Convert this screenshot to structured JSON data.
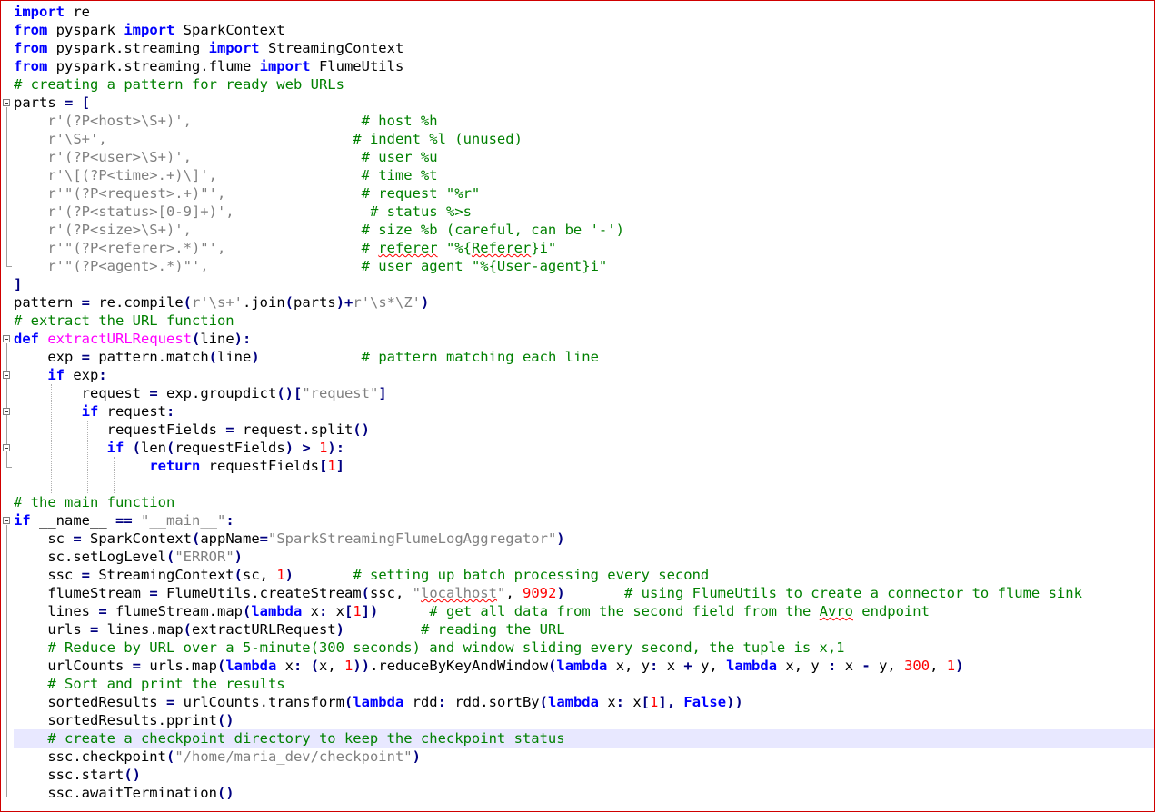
{
  "editor": {
    "language": "python",
    "current_line": 41,
    "colors": {
      "keyword": "#0000ff",
      "comment": "#008000",
      "string": "#808080",
      "number": "#ff0000",
      "function_def": "#ff00ff",
      "current_line_bg": "#e8e8ff",
      "frame_border": "#d00000"
    },
    "lines": [
      [
        [
          "kw",
          "import"
        ],
        [
          "t",
          " re"
        ]
      ],
      [
        [
          "kw",
          "from"
        ],
        [
          "t",
          " pyspark "
        ],
        [
          "kw",
          "import"
        ],
        [
          "t",
          " SparkContext"
        ]
      ],
      [
        [
          "kw",
          "from"
        ],
        [
          "t",
          " pyspark.streaming "
        ],
        [
          "kw",
          "import"
        ],
        [
          "t",
          " StreamingContext"
        ]
      ],
      [
        [
          "kw",
          "from"
        ],
        [
          "t",
          " pyspark.streaming.flume "
        ],
        [
          "kw",
          "import"
        ],
        [
          "t",
          " FlumeUtils"
        ]
      ],
      [
        [
          "cm",
          "# creating a pattern for ready web URLs"
        ]
      ],
      [
        [
          "t",
          "parts "
        ],
        [
          "op",
          "="
        ],
        [
          "t",
          " "
        ],
        [
          "op",
          "["
        ]
      ],
      [
        [
          "t",
          "    "
        ],
        [
          "st",
          "r'(?P<host>\\S+)',"
        ],
        [
          "t",
          "                    "
        ],
        [
          "cm",
          "# host %h"
        ]
      ],
      [
        [
          "t",
          "    "
        ],
        [
          "st",
          "r'\\S+',"
        ],
        [
          "t",
          "                             "
        ],
        [
          "cm",
          "# indent %l (unused)"
        ]
      ],
      [
        [
          "t",
          "    "
        ],
        [
          "st",
          "r'(?P<user>\\S+)',"
        ],
        [
          "t",
          "                    "
        ],
        [
          "cm",
          "# user %u"
        ]
      ],
      [
        [
          "t",
          "    "
        ],
        [
          "st",
          "r'\\[(?P<time>.+)\\]',"
        ],
        [
          "t",
          "                 "
        ],
        [
          "cm",
          "# time %t"
        ]
      ],
      [
        [
          "t",
          "    "
        ],
        [
          "st",
          "r'\"(?P<request>.+)\"',"
        ],
        [
          "t",
          "                "
        ],
        [
          "cm",
          "# request \"%r\""
        ]
      ],
      [
        [
          "t",
          "    "
        ],
        [
          "st",
          "r'(?P<status>[0-9]+)',"
        ],
        [
          "t",
          "                "
        ],
        [
          "cm",
          "# status %>s"
        ]
      ],
      [
        [
          "t",
          "    "
        ],
        [
          "st",
          "r'(?P<size>\\S+)',"
        ],
        [
          "t",
          "                    "
        ],
        [
          "cm",
          "# size %b (careful, can be '-')"
        ]
      ],
      [
        [
          "t",
          "    "
        ],
        [
          "st",
          "r'\"(?P<referer>.*)\"',"
        ],
        [
          "t",
          "                "
        ],
        [
          "cm",
          "# "
        ],
        [
          "cmsq",
          "referer"
        ],
        [
          "cm",
          " \"%{"
        ],
        [
          "cmsq",
          "Referer"
        ],
        [
          "cm",
          "}i\""
        ]
      ],
      [
        [
          "t",
          "    "
        ],
        [
          "st",
          "r'\"(?P<agent>.*)\"',"
        ],
        [
          "t",
          "                  "
        ],
        [
          "cm",
          "# user agent \"%{User-agent}i\""
        ]
      ],
      [
        [
          "op",
          "]"
        ]
      ],
      [
        [
          "t",
          "pattern "
        ],
        [
          "op",
          "="
        ],
        [
          "t",
          " re.compile"
        ],
        [
          "op",
          "("
        ],
        [
          "st",
          "r'\\s+'"
        ],
        [
          "t",
          ".join"
        ],
        [
          "op",
          "("
        ],
        [
          "t",
          "parts"
        ],
        [
          "op",
          ")+"
        ],
        [
          "st",
          "r'\\s*\\Z'"
        ],
        [
          "op",
          ")"
        ]
      ],
      [
        [
          "cm",
          "# extract the URL function"
        ]
      ],
      [
        [
          "kw",
          "def"
        ],
        [
          "t",
          " "
        ],
        [
          "fn",
          "extractURLRequest"
        ],
        [
          "op",
          "("
        ],
        [
          "t",
          "line"
        ],
        [
          "op",
          "):"
        ]
      ],
      [
        [
          "t",
          "    exp "
        ],
        [
          "op",
          "="
        ],
        [
          "t",
          " pattern.match"
        ],
        [
          "op",
          "("
        ],
        [
          "t",
          "line"
        ],
        [
          "op",
          ")"
        ],
        [
          "t",
          "            "
        ],
        [
          "cm",
          "# pattern matching each line"
        ]
      ],
      [
        [
          "t",
          "    "
        ],
        [
          "kw",
          "if"
        ],
        [
          "t",
          " exp"
        ],
        [
          "op",
          ":"
        ]
      ],
      [
        [
          "t",
          "        request "
        ],
        [
          "op",
          "="
        ],
        [
          "t",
          " exp.groupdict"
        ],
        [
          "op",
          "()["
        ],
        [
          "st",
          "\"request\""
        ],
        [
          "op",
          "]"
        ]
      ],
      [
        [
          "t",
          "        "
        ],
        [
          "kw",
          "if"
        ],
        [
          "t",
          " request"
        ],
        [
          "op",
          ":"
        ]
      ],
      [
        [
          "t",
          "           requestFields "
        ],
        [
          "op",
          "="
        ],
        [
          "t",
          " request.split"
        ],
        [
          "op",
          "()"
        ]
      ],
      [
        [
          "t",
          "           "
        ],
        [
          "kw",
          "if"
        ],
        [
          "t",
          " "
        ],
        [
          "op",
          "("
        ],
        [
          "t",
          "len"
        ],
        [
          "op",
          "("
        ],
        [
          "t",
          "requestFields"
        ],
        [
          "op",
          ")"
        ],
        [
          "t",
          " "
        ],
        [
          "op",
          ">"
        ],
        [
          "t",
          " "
        ],
        [
          "nm",
          "1"
        ],
        [
          "op",
          "):"
        ]
      ],
      [
        [
          "t",
          "                "
        ],
        [
          "kw",
          "return"
        ],
        [
          "t",
          " requestFields"
        ],
        [
          "op",
          "["
        ],
        [
          "nm",
          "1"
        ],
        [
          "op",
          "]"
        ]
      ],
      [],
      [
        [
          "cm",
          "# the main function"
        ]
      ],
      [
        [
          "kw",
          "if"
        ],
        [
          "t",
          " __name__ "
        ],
        [
          "op",
          "=="
        ],
        [
          "t",
          " "
        ],
        [
          "st",
          "\"__main__\""
        ],
        [
          "op",
          ":"
        ]
      ],
      [
        [
          "t",
          "    sc "
        ],
        [
          "op",
          "="
        ],
        [
          "t",
          " SparkContext"
        ],
        [
          "op",
          "("
        ],
        [
          "t",
          "appName"
        ],
        [
          "op",
          "="
        ],
        [
          "st",
          "\"SparkStreamingFlumeLogAggregator\""
        ],
        [
          "op",
          ")"
        ]
      ],
      [
        [
          "t",
          "    sc.setLogLevel"
        ],
        [
          "op",
          "("
        ],
        [
          "st",
          "\"ERROR\""
        ],
        [
          "op",
          ")"
        ]
      ],
      [
        [
          "t",
          "    ssc "
        ],
        [
          "op",
          "="
        ],
        [
          "t",
          " StreamingContext"
        ],
        [
          "op",
          "("
        ],
        [
          "t",
          "sc, "
        ],
        [
          "nm",
          "1"
        ],
        [
          "op",
          ")"
        ],
        [
          "t",
          "       "
        ],
        [
          "cm",
          "# setting up batch processing every second"
        ]
      ],
      [
        [
          "t",
          "    flumeStream "
        ],
        [
          "op",
          "="
        ],
        [
          "t",
          " FlumeUtils.createStream"
        ],
        [
          "op",
          "("
        ],
        [
          "t",
          "ssc, "
        ],
        [
          "st",
          "\""
        ],
        [
          "stsq",
          "localhost"
        ],
        [
          "st",
          "\""
        ],
        [
          "t",
          ", "
        ],
        [
          "nm",
          "9092"
        ],
        [
          "op",
          ")"
        ],
        [
          "t",
          "       "
        ],
        [
          "cm",
          "# using FlumeUtils to create a connector to flume sink"
        ]
      ],
      [
        [
          "t",
          "    lines "
        ],
        [
          "op",
          "="
        ],
        [
          "t",
          " flumeStream.map"
        ],
        [
          "op",
          "("
        ],
        [
          "kw",
          "lambda"
        ],
        [
          "t",
          " x"
        ],
        [
          "op",
          ":"
        ],
        [
          "t",
          " x"
        ],
        [
          "op",
          "["
        ],
        [
          "nm",
          "1"
        ],
        [
          "op",
          "])"
        ],
        [
          "t",
          "      "
        ],
        [
          "cm",
          "# get all data from the second field from the "
        ],
        [
          "cmsq",
          "Avro"
        ],
        [
          "cm",
          " endpoint"
        ]
      ],
      [
        [
          "t",
          "    urls "
        ],
        [
          "op",
          "="
        ],
        [
          "t",
          " lines.map"
        ],
        [
          "op",
          "("
        ],
        [
          "t",
          "extractURLRequest"
        ],
        [
          "op",
          ")"
        ],
        [
          "t",
          "         "
        ],
        [
          "cm",
          "# reading the URL"
        ]
      ],
      [
        [
          "t",
          "    "
        ],
        [
          "cm",
          "# Reduce by URL over a 5-minute(300 seconds) and window sliding every second, the tuple is x,1"
        ]
      ],
      [
        [
          "t",
          "    urlCounts "
        ],
        [
          "op",
          "="
        ],
        [
          "t",
          " urls.map"
        ],
        [
          "op",
          "("
        ],
        [
          "kw",
          "lambda"
        ],
        [
          "t",
          " x"
        ],
        [
          "op",
          ":"
        ],
        [
          "t",
          " "
        ],
        [
          "op",
          "("
        ],
        [
          "t",
          "x, "
        ],
        [
          "nm",
          "1"
        ],
        [
          "op",
          "))"
        ],
        [
          "t",
          ".reduceByKeyAndWindow"
        ],
        [
          "op",
          "("
        ],
        [
          "kw",
          "lambda"
        ],
        [
          "t",
          " x, y"
        ],
        [
          "op",
          ":"
        ],
        [
          "t",
          " x "
        ],
        [
          "op",
          "+"
        ],
        [
          "t",
          " y, "
        ],
        [
          "kw",
          "lambda"
        ],
        [
          "t",
          " x, y "
        ],
        [
          "op",
          ":"
        ],
        [
          "t",
          " x "
        ],
        [
          "op",
          "-"
        ],
        [
          "t",
          " y, "
        ],
        [
          "nm",
          "300"
        ],
        [
          "t",
          ", "
        ],
        [
          "nm",
          "1"
        ],
        [
          "op",
          ")"
        ]
      ],
      [
        [
          "t",
          "    "
        ],
        [
          "cm",
          "# Sort and print the results"
        ]
      ],
      [
        [
          "t",
          "    sortedResults "
        ],
        [
          "op",
          "="
        ],
        [
          "t",
          " urlCounts.transform"
        ],
        [
          "op",
          "("
        ],
        [
          "kw",
          "lambda"
        ],
        [
          "t",
          " rdd"
        ],
        [
          "op",
          ":"
        ],
        [
          "t",
          " rdd.sortBy"
        ],
        [
          "op",
          "("
        ],
        [
          "kw",
          "lambda"
        ],
        [
          "t",
          " x"
        ],
        [
          "op",
          ":"
        ],
        [
          "t",
          " x"
        ],
        [
          "op",
          "["
        ],
        [
          "nm",
          "1"
        ],
        [
          "op",
          "],"
        ],
        [
          "t",
          " "
        ],
        [
          "kw",
          "False"
        ],
        [
          "op",
          "))"
        ]
      ],
      [
        [
          "t",
          "    sortedResults.pprint"
        ],
        [
          "op",
          "()"
        ]
      ],
      [
        [
          "t",
          "    "
        ],
        [
          "cm",
          "# create a checkpoint directory to keep the checkpoint status"
        ]
      ],
      [
        [
          "t",
          "    ssc.checkpoint"
        ],
        [
          "op",
          "("
        ],
        [
          "st",
          "\"/home/maria_dev/checkpoint\""
        ],
        [
          "op",
          ")"
        ]
      ],
      [
        [
          "t",
          "    ssc.start"
        ],
        [
          "op",
          "()"
        ]
      ],
      [
        [
          "t",
          "    ssc.awaitTermination"
        ],
        [
          "op",
          "()"
        ]
      ]
    ]
  }
}
